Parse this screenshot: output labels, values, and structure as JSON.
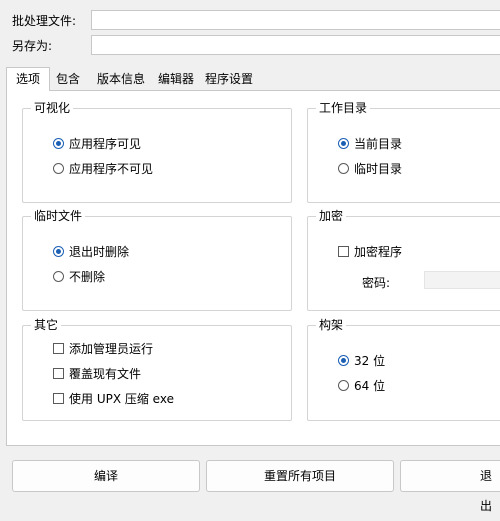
{
  "top": {
    "batch_label": "批处理文件:",
    "saveas_label": "另存为:"
  },
  "tabs": [
    {
      "label": "选项",
      "active": true
    },
    {
      "label": "包含"
    },
    {
      "label": "版本信息"
    },
    {
      "label": "编辑器"
    },
    {
      "label": "程序设置"
    }
  ],
  "groups": {
    "visibility": {
      "title": "可视化",
      "opt_visible": "应用程序可见",
      "opt_invisible": "应用程序不可见"
    },
    "workdir": {
      "title": "工作目录",
      "opt_current": "当前目录",
      "opt_temp": "临时目录"
    },
    "tempfiles": {
      "title": "临时文件",
      "opt_delete_on_exit": "退出时删除",
      "opt_no_delete": "不删除"
    },
    "encryption": {
      "title": "加密",
      "encrypt_program": "加密程序",
      "password_label": "密码:"
    },
    "other": {
      "title": "其它",
      "add_admin": "添加管理员运行",
      "overwrite": "覆盖现有文件",
      "use_upx": "使用 UPX 压缩 exe"
    },
    "arch": {
      "title": "构架",
      "opt_32": "32 位",
      "opt_64": "64 位"
    }
  },
  "buttons": {
    "compile": "编译",
    "reset": "重置所有项目",
    "exit": "退出"
  },
  "colors": {
    "accent": "#1a5fb4",
    "background": "#f0f0f0"
  }
}
